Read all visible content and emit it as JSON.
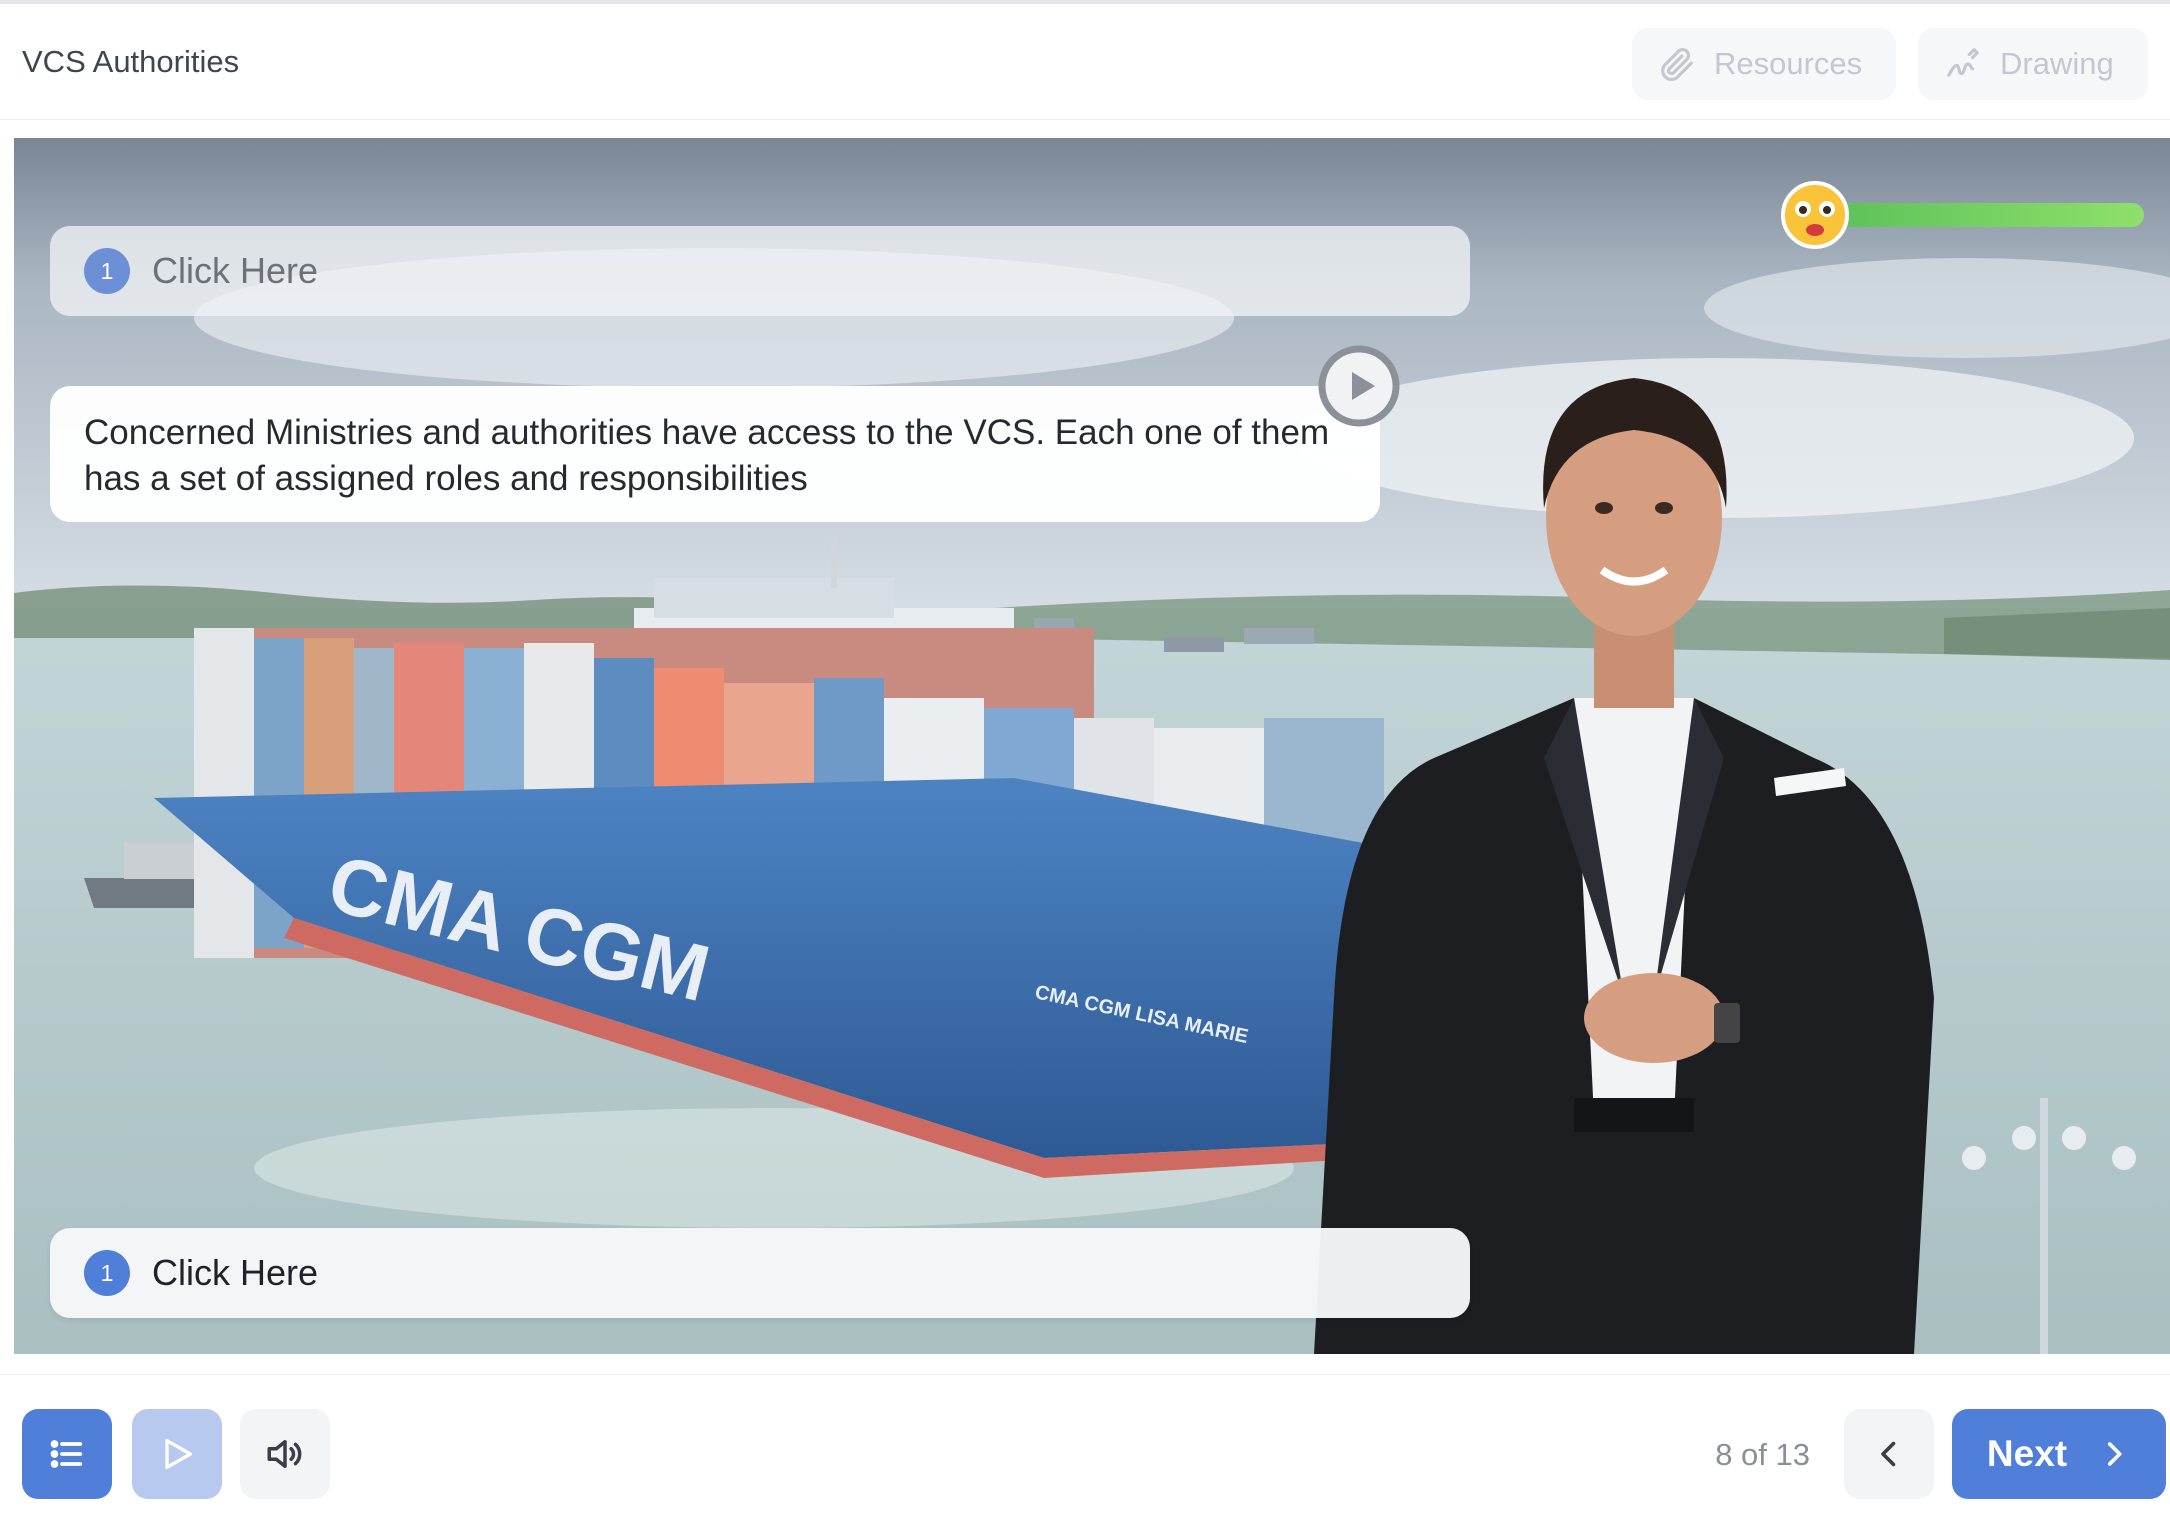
{
  "header": {
    "title": "VCS Authorities",
    "resources_label": "Resources",
    "drawing_label": "Drawing"
  },
  "slide": {
    "click_top": {
      "number": "1",
      "label": "Click Here"
    },
    "speech": "Concerned Ministries and authorities have access to the VCS. Each one of them has a set of assigned roles and responsibilities",
    "click_bottom": {
      "number": "1",
      "label": "Click Here"
    },
    "ship_text": {
      "hull": "CMA CGM",
      "name": "CMA CGM LISA MARIE"
    },
    "progress_fraction": 1.0,
    "progress_color": "#7ed957"
  },
  "footer": {
    "page_count": "8 of 13",
    "next_label": "Next"
  },
  "colors": {
    "accent": "#4f7fd9",
    "accent_light": "#b7c9ef"
  }
}
